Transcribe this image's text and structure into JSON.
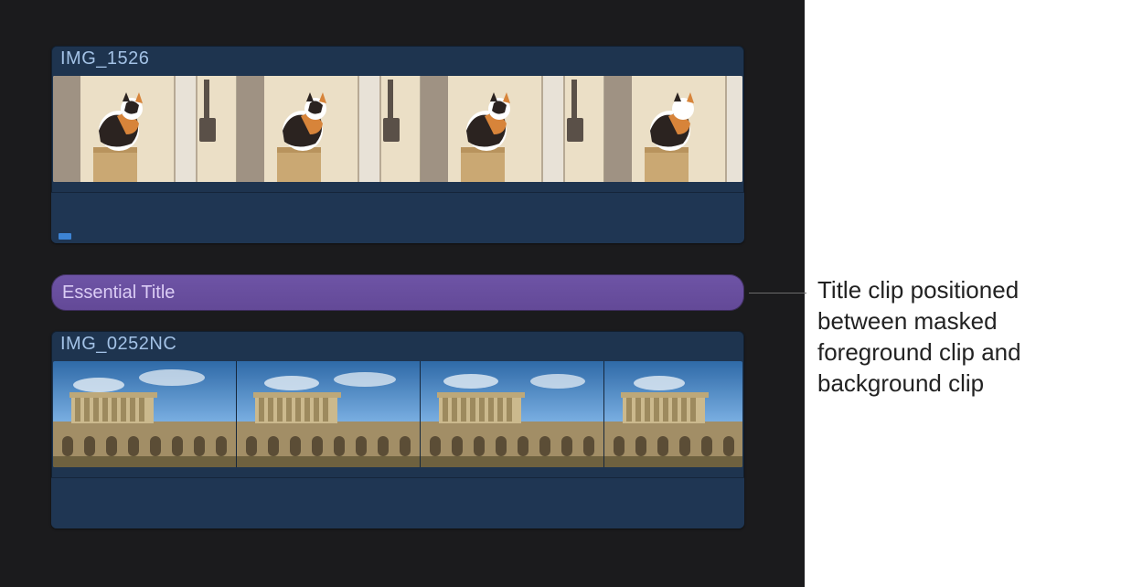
{
  "timeline": {
    "foreground_clip": {
      "name": "IMG_1526"
    },
    "title_clip": {
      "name": "Essential Title"
    },
    "background_clip": {
      "name": "IMG_0252NC"
    }
  },
  "callout": {
    "text": "Title clip positioned between masked foreground clip and background clip"
  },
  "colors": {
    "panel_bg": "#1b1b1d",
    "clip_bg": "#1e344f",
    "clip_label": "#a3c2e6",
    "title_bg": "#634997",
    "title_label": "#dbcdf5"
  }
}
